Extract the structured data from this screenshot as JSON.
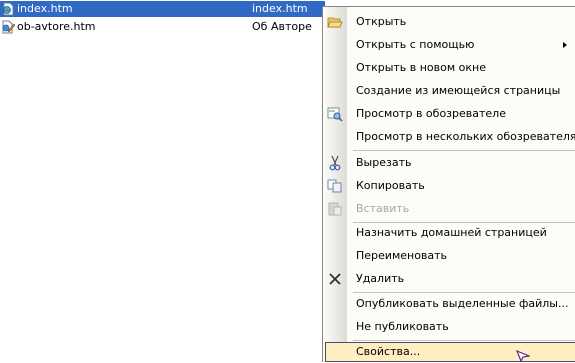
{
  "files": [
    {
      "name": "index.htm",
      "title": "index.htm",
      "selected": true,
      "icon": "web-page-icon"
    },
    {
      "name": "ob-avtore.htm",
      "title": "Об Авторе",
      "selected": false,
      "icon": "web-page-edit-icon"
    }
  ],
  "menu": {
    "open": "Открыть",
    "open_with": "Открыть с помощью",
    "open_new_window": "Открыть в новом окне",
    "new_from_existing": "Создание из имеющейся страницы",
    "preview_browser": "Просмотр в обозревателе",
    "preview_multiple": "Просмотр в нескольких обозревателях",
    "cut": "Вырезать",
    "copy": "Копировать",
    "paste": "Вставить",
    "set_home": "Назначить домашней страницей",
    "rename": "Переименовать",
    "delete": "Удалить",
    "publish_selected": "Опубликовать выделенные файлы...",
    "do_not_publish": "Не публиковать",
    "properties": "Свойства..."
  },
  "colors": {
    "selection": "#316ac5",
    "hover": "#ffeec2",
    "disabled": "#aca899"
  }
}
